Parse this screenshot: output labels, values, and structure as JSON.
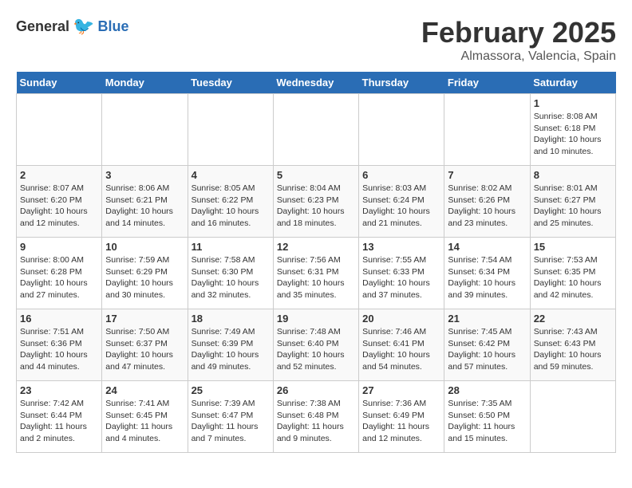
{
  "logo": {
    "general": "General",
    "blue": "Blue"
  },
  "title": "February 2025",
  "subtitle": "Almassora, Valencia, Spain",
  "days_of_week": [
    "Sunday",
    "Monday",
    "Tuesday",
    "Wednesday",
    "Thursday",
    "Friday",
    "Saturday"
  ],
  "weeks": [
    [
      {
        "day": "",
        "info": ""
      },
      {
        "day": "",
        "info": ""
      },
      {
        "day": "",
        "info": ""
      },
      {
        "day": "",
        "info": ""
      },
      {
        "day": "",
        "info": ""
      },
      {
        "day": "",
        "info": ""
      },
      {
        "day": "1",
        "info": "Sunrise: 8:08 AM\nSunset: 6:18 PM\nDaylight: 10 hours\nand 10 minutes."
      }
    ],
    [
      {
        "day": "2",
        "info": "Sunrise: 8:07 AM\nSunset: 6:20 PM\nDaylight: 10 hours\nand 12 minutes."
      },
      {
        "day": "3",
        "info": "Sunrise: 8:06 AM\nSunset: 6:21 PM\nDaylight: 10 hours\nand 14 minutes."
      },
      {
        "day": "4",
        "info": "Sunrise: 8:05 AM\nSunset: 6:22 PM\nDaylight: 10 hours\nand 16 minutes."
      },
      {
        "day": "5",
        "info": "Sunrise: 8:04 AM\nSunset: 6:23 PM\nDaylight: 10 hours\nand 18 minutes."
      },
      {
        "day": "6",
        "info": "Sunrise: 8:03 AM\nSunset: 6:24 PM\nDaylight: 10 hours\nand 21 minutes."
      },
      {
        "day": "7",
        "info": "Sunrise: 8:02 AM\nSunset: 6:26 PM\nDaylight: 10 hours\nand 23 minutes."
      },
      {
        "day": "8",
        "info": "Sunrise: 8:01 AM\nSunset: 6:27 PM\nDaylight: 10 hours\nand 25 minutes."
      }
    ],
    [
      {
        "day": "9",
        "info": "Sunrise: 8:00 AM\nSunset: 6:28 PM\nDaylight: 10 hours\nand 27 minutes."
      },
      {
        "day": "10",
        "info": "Sunrise: 7:59 AM\nSunset: 6:29 PM\nDaylight: 10 hours\nand 30 minutes."
      },
      {
        "day": "11",
        "info": "Sunrise: 7:58 AM\nSunset: 6:30 PM\nDaylight: 10 hours\nand 32 minutes."
      },
      {
        "day": "12",
        "info": "Sunrise: 7:56 AM\nSunset: 6:31 PM\nDaylight: 10 hours\nand 35 minutes."
      },
      {
        "day": "13",
        "info": "Sunrise: 7:55 AM\nSunset: 6:33 PM\nDaylight: 10 hours\nand 37 minutes."
      },
      {
        "day": "14",
        "info": "Sunrise: 7:54 AM\nSunset: 6:34 PM\nDaylight: 10 hours\nand 39 minutes."
      },
      {
        "day": "15",
        "info": "Sunrise: 7:53 AM\nSunset: 6:35 PM\nDaylight: 10 hours\nand 42 minutes."
      }
    ],
    [
      {
        "day": "16",
        "info": "Sunrise: 7:51 AM\nSunset: 6:36 PM\nDaylight: 10 hours\nand 44 minutes."
      },
      {
        "day": "17",
        "info": "Sunrise: 7:50 AM\nSunset: 6:37 PM\nDaylight: 10 hours\nand 47 minutes."
      },
      {
        "day": "18",
        "info": "Sunrise: 7:49 AM\nSunset: 6:39 PM\nDaylight: 10 hours\nand 49 minutes."
      },
      {
        "day": "19",
        "info": "Sunrise: 7:48 AM\nSunset: 6:40 PM\nDaylight: 10 hours\nand 52 minutes."
      },
      {
        "day": "20",
        "info": "Sunrise: 7:46 AM\nSunset: 6:41 PM\nDaylight: 10 hours\nand 54 minutes."
      },
      {
        "day": "21",
        "info": "Sunrise: 7:45 AM\nSunset: 6:42 PM\nDaylight: 10 hours\nand 57 minutes."
      },
      {
        "day": "22",
        "info": "Sunrise: 7:43 AM\nSunset: 6:43 PM\nDaylight: 10 hours\nand 59 minutes."
      }
    ],
    [
      {
        "day": "23",
        "info": "Sunrise: 7:42 AM\nSunset: 6:44 PM\nDaylight: 11 hours\nand 2 minutes."
      },
      {
        "day": "24",
        "info": "Sunrise: 7:41 AM\nSunset: 6:45 PM\nDaylight: 11 hours\nand 4 minutes."
      },
      {
        "day": "25",
        "info": "Sunrise: 7:39 AM\nSunset: 6:47 PM\nDaylight: 11 hours\nand 7 minutes."
      },
      {
        "day": "26",
        "info": "Sunrise: 7:38 AM\nSunset: 6:48 PM\nDaylight: 11 hours\nand 9 minutes."
      },
      {
        "day": "27",
        "info": "Sunrise: 7:36 AM\nSunset: 6:49 PM\nDaylight: 11 hours\nand 12 minutes."
      },
      {
        "day": "28",
        "info": "Sunrise: 7:35 AM\nSunset: 6:50 PM\nDaylight: 11 hours\nand 15 minutes."
      },
      {
        "day": "",
        "info": ""
      }
    ]
  ]
}
